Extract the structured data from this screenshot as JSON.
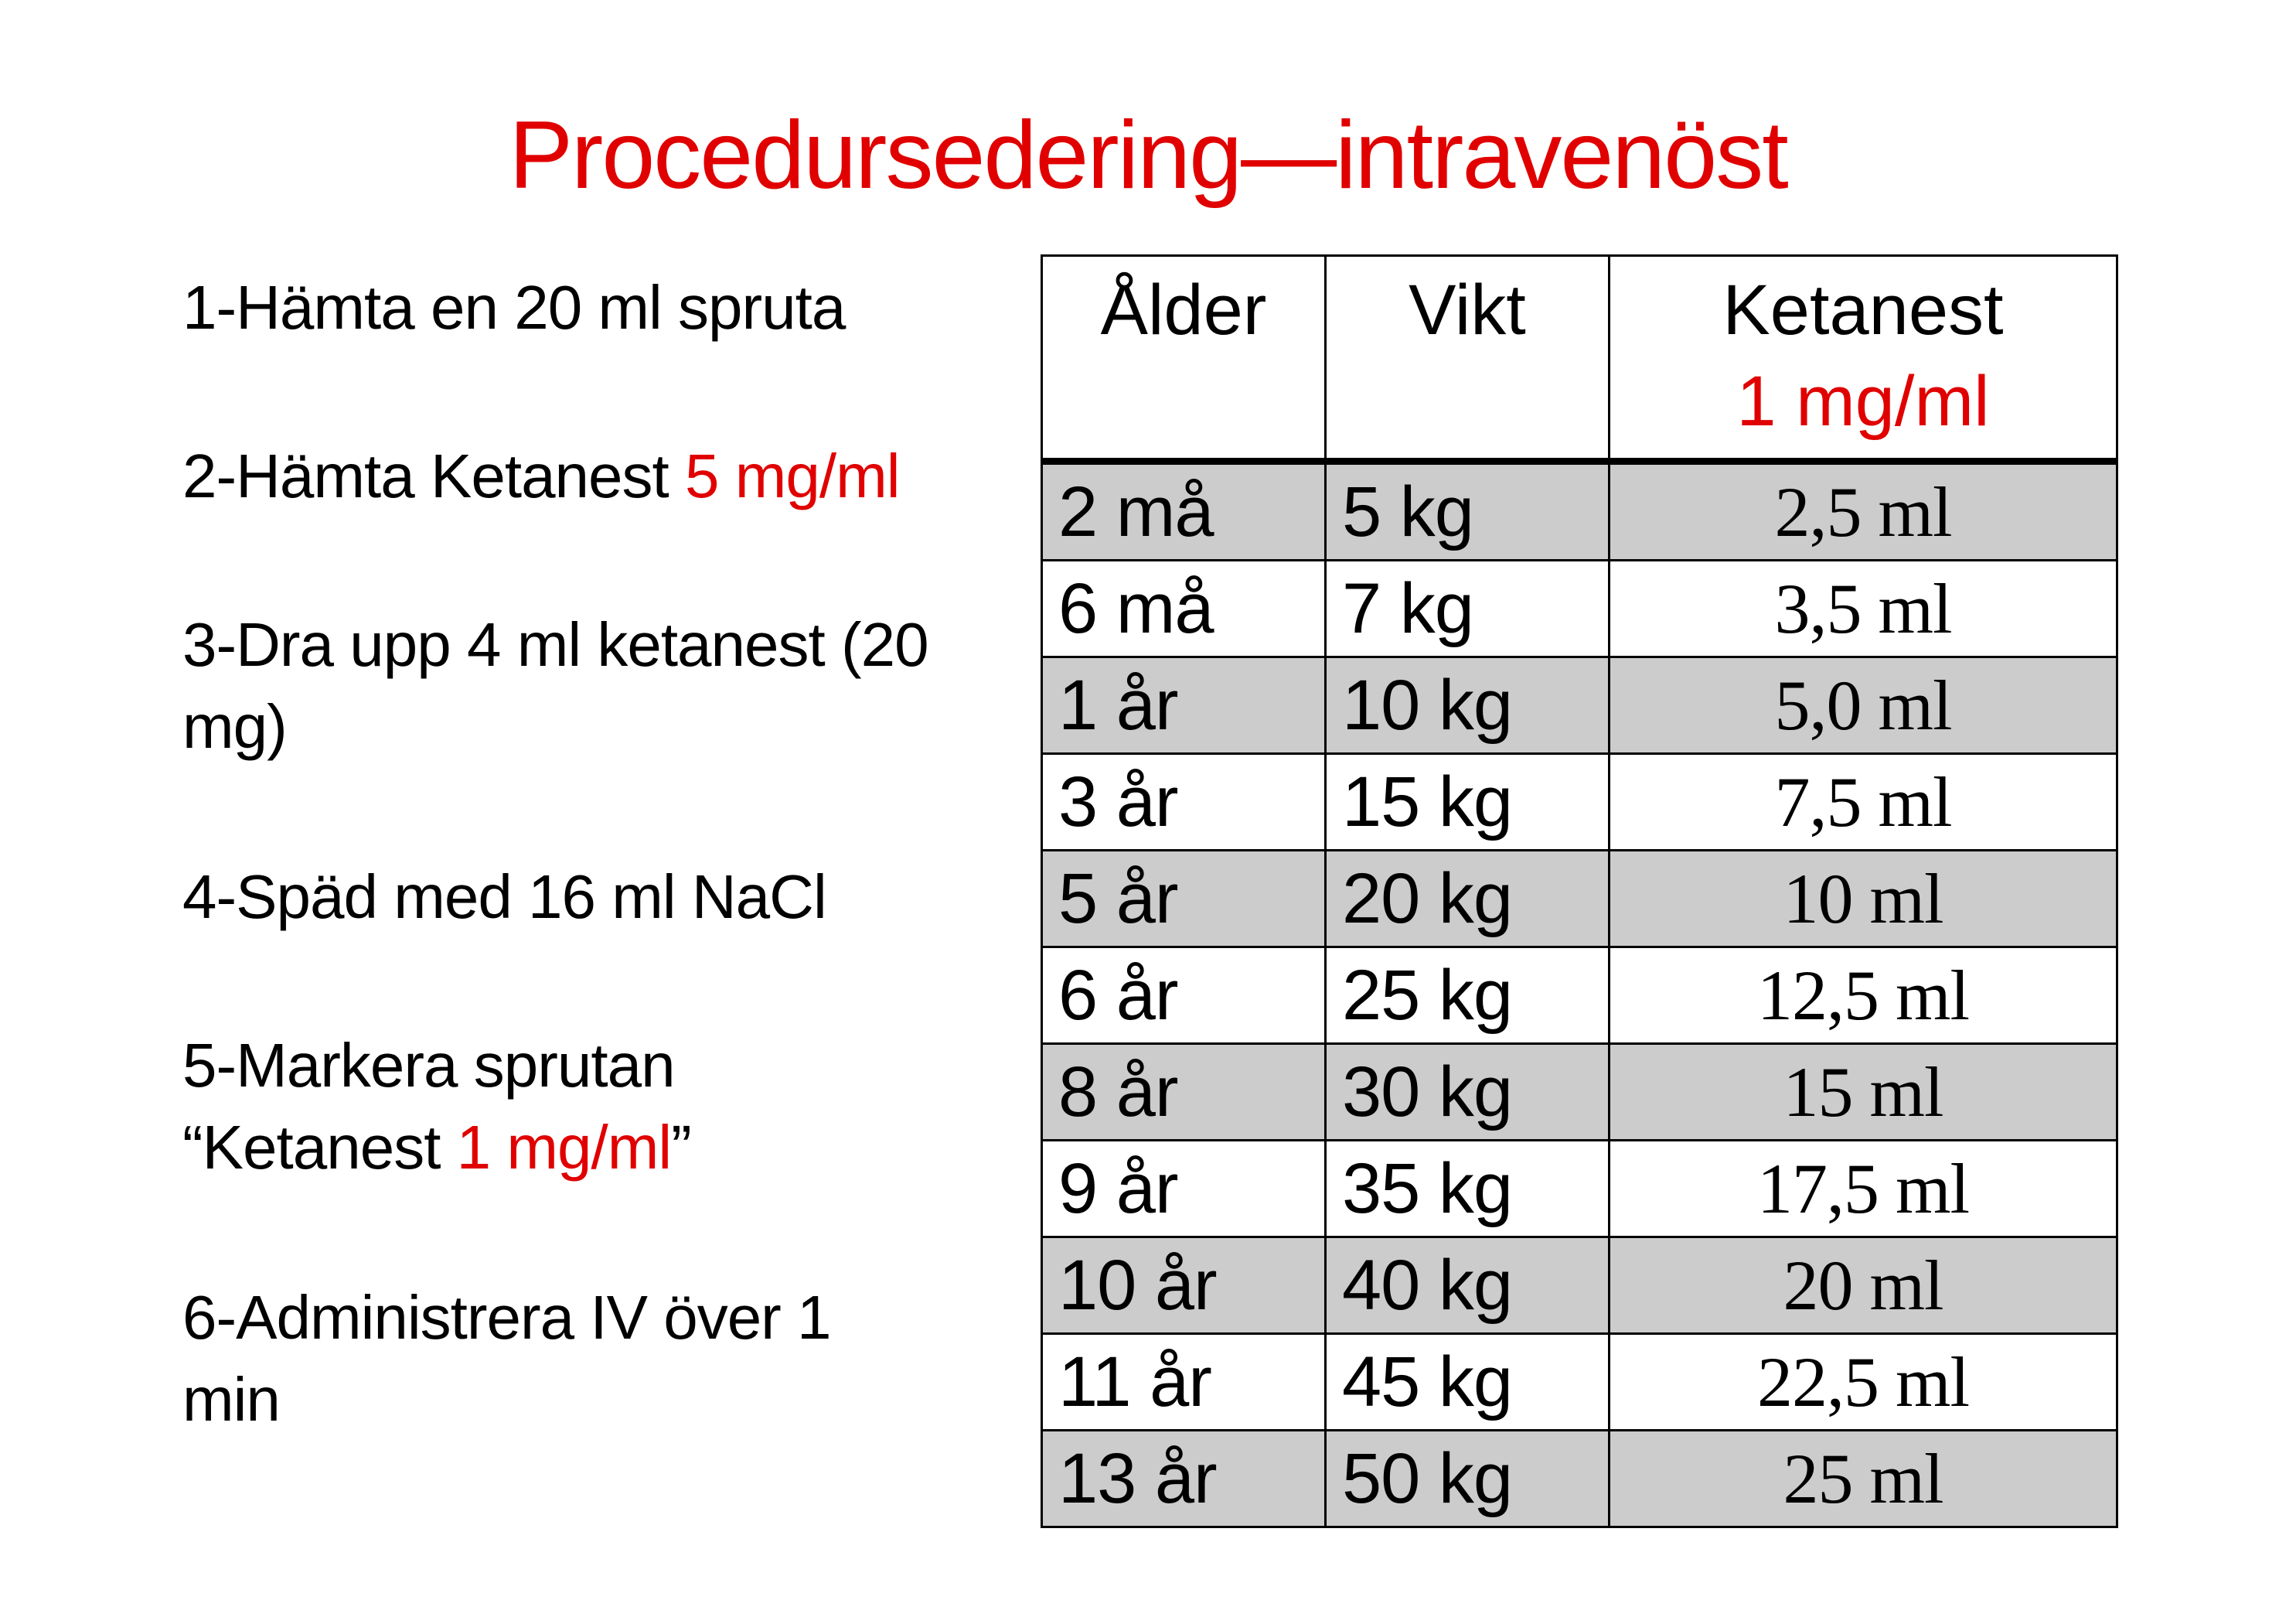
{
  "title": "Procedursedering—intravenöst",
  "steps": [
    {
      "text": "1-Hämta en 20 ml spruta"
    },
    {
      "text": "2-Hämta Ketanest ",
      "red": "5 mg/ml"
    },
    {
      "text": "3-Dra upp 4 ml ketanest (20 mg)"
    },
    {
      "text": "4-Späd med 16 ml NaCl"
    },
    {
      "text": "5-Markera sprutan “Ketanest ",
      "red": "1 mg/ml",
      "after": "”"
    },
    {
      "text": "6-Administrera IV över 1 min"
    }
  ],
  "table": {
    "headers": {
      "age": "Ålder",
      "weight": "Vikt",
      "dose": "Ketanest",
      "dose_sub": "1 mg/ml"
    },
    "rows": [
      {
        "age": "2 må",
        "weight": "5 kg",
        "dose": "2,5 ml"
      },
      {
        "age": "6 må",
        "weight": "7 kg",
        "dose": "3,5 ml"
      },
      {
        "age": "1 år",
        "weight": "10 kg",
        "dose": "5,0 ml"
      },
      {
        "age": "3 år",
        "weight": "15 kg",
        "dose": "7,5 ml"
      },
      {
        "age": "5 år",
        "weight": "20 kg",
        "dose": "10 ml"
      },
      {
        "age": "6 år",
        "weight": "25 kg",
        "dose": "12,5 ml"
      },
      {
        "age": "8 år",
        "weight": "30 kg",
        "dose": "15 ml"
      },
      {
        "age": "9 år",
        "weight": "35 kg",
        "dose": "17,5 ml"
      },
      {
        "age": "10 år",
        "weight": "40 kg",
        "dose": "20 ml"
      },
      {
        "age": "11 år",
        "weight": "45 kg",
        "dose": "22,5 ml"
      },
      {
        "age": "13 år",
        "weight": "50 kg",
        "dose": "25 ml"
      }
    ]
  },
  "colors": {
    "accent": "#e00000",
    "row_shade": "#cccccc"
  }
}
